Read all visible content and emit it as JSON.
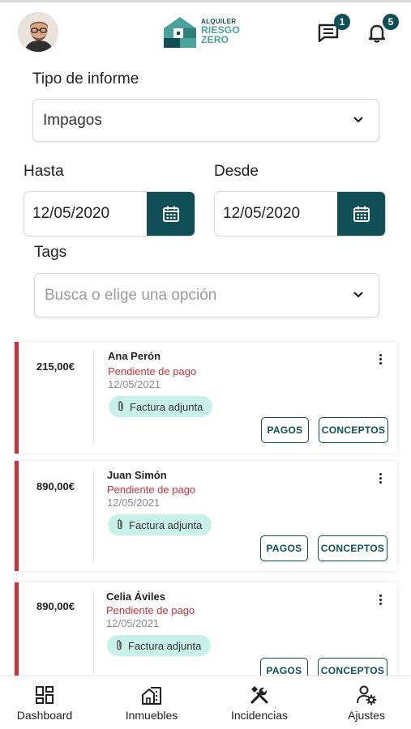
{
  "header": {
    "logo": {
      "line1": "ALQUILER",
      "line2": "RIESGO",
      "line3": "ZERO"
    },
    "messages_badge": "1",
    "notifications_badge": "5"
  },
  "form": {
    "report_type_label": "Tipo de informe",
    "report_type_value": "Impagos",
    "hasta_label": "Hasta",
    "hasta_value": "12/05/2020",
    "desde_label": "Desde",
    "desde_value": "12/05/2020",
    "tags_label": "Tags",
    "tags_placeholder": "Busca o elige una opción"
  },
  "cards": [
    {
      "amount": "215,00€",
      "name": "Ana Perón",
      "status": "Pendiente de pago",
      "date": "12/05/2021",
      "chip": "Factura adjunta",
      "btn_pagos": "PAGOS",
      "btn_conceptos": "CONCEPTOS"
    },
    {
      "amount": "890,00€",
      "name": "Juan Simón",
      "status": "Pendiente de pago",
      "date": "12/05/2021",
      "chip": "Factura adjunta",
      "btn_pagos": "PAGOS",
      "btn_conceptos": "CONCEPTOS"
    },
    {
      "amount": "890,00€",
      "name": "Celia Áviles",
      "status": "Pendiente de pago",
      "date": "12/05/2021",
      "chip": "Factura adjunta",
      "btn_pagos": "PAGOS",
      "btn_conceptos": "CONCEPTOS"
    }
  ],
  "nav": {
    "dashboard": "Dashboard",
    "inmuebles": "Inmuebles",
    "incidencias": "Incidencias",
    "ajustes": "Ajustes"
  },
  "icons": {
    "avatar": "user-avatar",
    "messages": "chat-icon",
    "notifications": "bell-icon",
    "calendar": "calendar-icon",
    "chevron": "chevron-down-icon",
    "attachment": "paperclip-icon",
    "more": "kebab-menu-icon"
  },
  "colors": {
    "brand_dark": "#0f4f55",
    "brand_light": "#4aa39a",
    "status_red": "#c8333a",
    "chip_bg": "#c8f1ea"
  }
}
